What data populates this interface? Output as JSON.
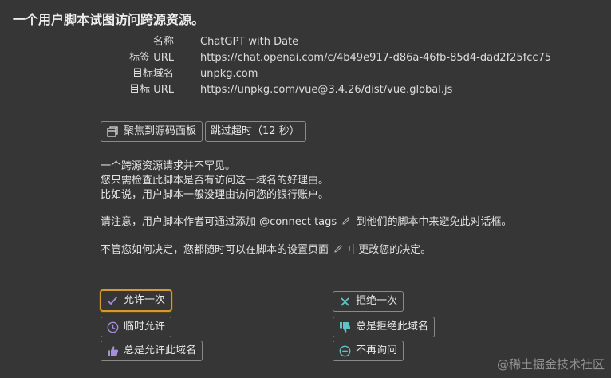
{
  "title": "一个用户脚本试图访问跨源资源。",
  "info": [
    {
      "label": "名称",
      "value": "ChatGPT with Date"
    },
    {
      "label": "标签 URL",
      "value": "https://chat.openai.com/c/4b49e917-d86a-46fb-85d4-dad2f25fcc75"
    },
    {
      "label": "目标域名",
      "value": "unpkg.com"
    },
    {
      "label": "目标 URL",
      "value": "https://unpkg.com/vue@3.4.26/dist/vue.global.js"
    }
  ],
  "toolbar": {
    "focus_label": "聚焦到源码面板",
    "skip_label": "跳过超时（12 秒）"
  },
  "message": {
    "line1": "一个跨源资源请求并不罕见。",
    "line2": "您只需检查此脚本是否有访问这一域名的好理由。",
    "line3": "比如说，用户脚本一般没理由访问您的银行账户。",
    "note_before": "请注意，用户脚本作者可通过添加 @connect tags",
    "note_after": "到他们的脚本中来避免此对话框。",
    "settings_before": "不管您如何决定，您都随时可以在脚本的设置页面",
    "settings_after": "中更改您的决定。"
  },
  "actions": {
    "allow_once": "允许一次",
    "allow_temp": "临时允许",
    "allow_domain": "总是允许此域名",
    "deny_once": "拒绝一次",
    "deny_domain": "总是拒绝此域名",
    "never_ask": "不再询问"
  },
  "watermark": "@稀土掘金技术社区",
  "colors": {
    "background": "#363636",
    "focus_border": "#d69a2e",
    "allow_icon": "#a48fd8",
    "deny_icon": "#5fc3c7"
  }
}
